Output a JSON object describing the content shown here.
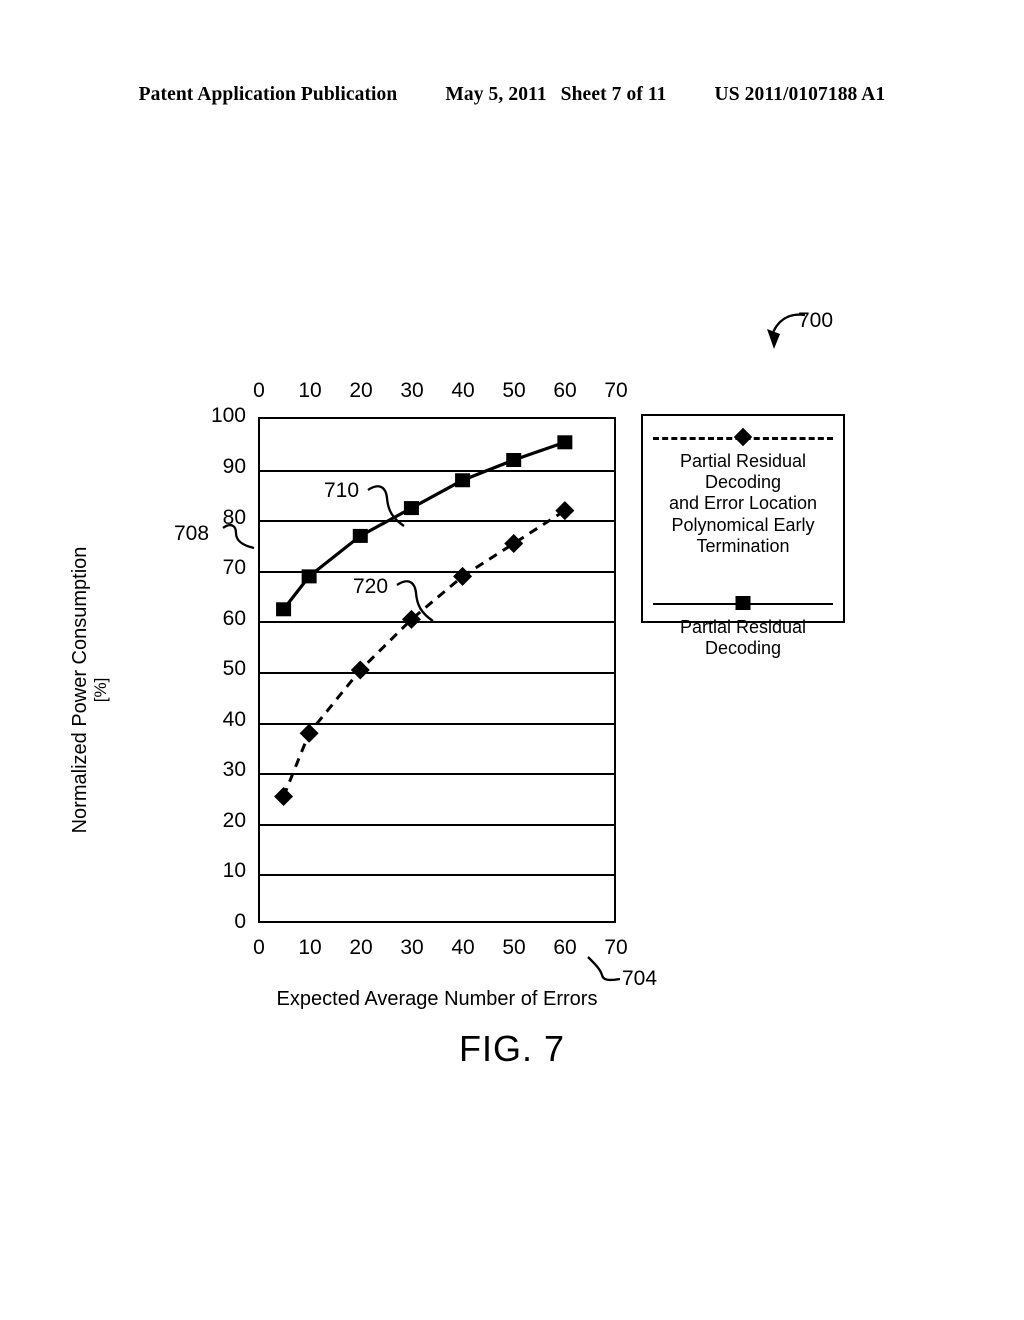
{
  "header": {
    "publication": "Patent Application Publication",
    "date": "May 5, 2011",
    "sheet": "Sheet 7 of 11",
    "patent_number": "US 2011/0107188 A1"
  },
  "figure": {
    "caption": "FIG. 7",
    "reference_figure": "700",
    "reference_x_axis": "704",
    "reference_y_axis": "708",
    "reference_series_squares": "710",
    "reference_series_diamonds": "720"
  },
  "legend": {
    "entries": [
      {
        "marker": "diamond",
        "line_style": "dashed",
        "label": "Partial Residual Decoding and Error Location Polynomical Early Termination",
        "label_lines": [
          "Partial Residual Decoding",
          "and Error Location",
          "Polynomical Early",
          "Termination"
        ]
      },
      {
        "marker": "square",
        "line_style": "solid",
        "label": "Partial Residual Decoding",
        "label_lines": [
          "Partial Residual Decoding"
        ]
      }
    ]
  },
  "chart_data": {
    "type": "line",
    "title": "",
    "xlabel": "Expected Average Number of Errors",
    "ylabel": "Normalized Power Consumption",
    "ylabel_unit": "[%]",
    "xlim": [
      0,
      70
    ],
    "ylim": [
      0,
      100
    ],
    "xticks": [
      0,
      10,
      20,
      30,
      40,
      50,
      60,
      70
    ],
    "yticks": [
      0,
      10,
      20,
      30,
      40,
      50,
      60,
      70,
      80,
      90,
      100
    ],
    "xticks_top": [
      0,
      10,
      20,
      30,
      40,
      50,
      60,
      70
    ],
    "grid": true,
    "legend_position": "right",
    "series": [
      {
        "name": "Partial Residual Decoding",
        "ref": "710",
        "marker": "square",
        "line_style": "solid",
        "color": "#000000",
        "x": [
          5,
          10,
          20,
          30,
          40,
          50,
          60
        ],
        "values": [
          62,
          68.5,
          76.5,
          82,
          87.5,
          91.5,
          95
        ]
      },
      {
        "name": "Partial Residual Decoding and Error Location Polynomical Early Termination",
        "ref": "720",
        "marker": "diamond",
        "line_style": "dashed",
        "color": "#000000",
        "x": [
          5,
          10,
          20,
          30,
          40,
          50,
          60
        ],
        "values": [
          25,
          37.5,
          50,
          60,
          68.5,
          75,
          81.5
        ]
      }
    ]
  }
}
